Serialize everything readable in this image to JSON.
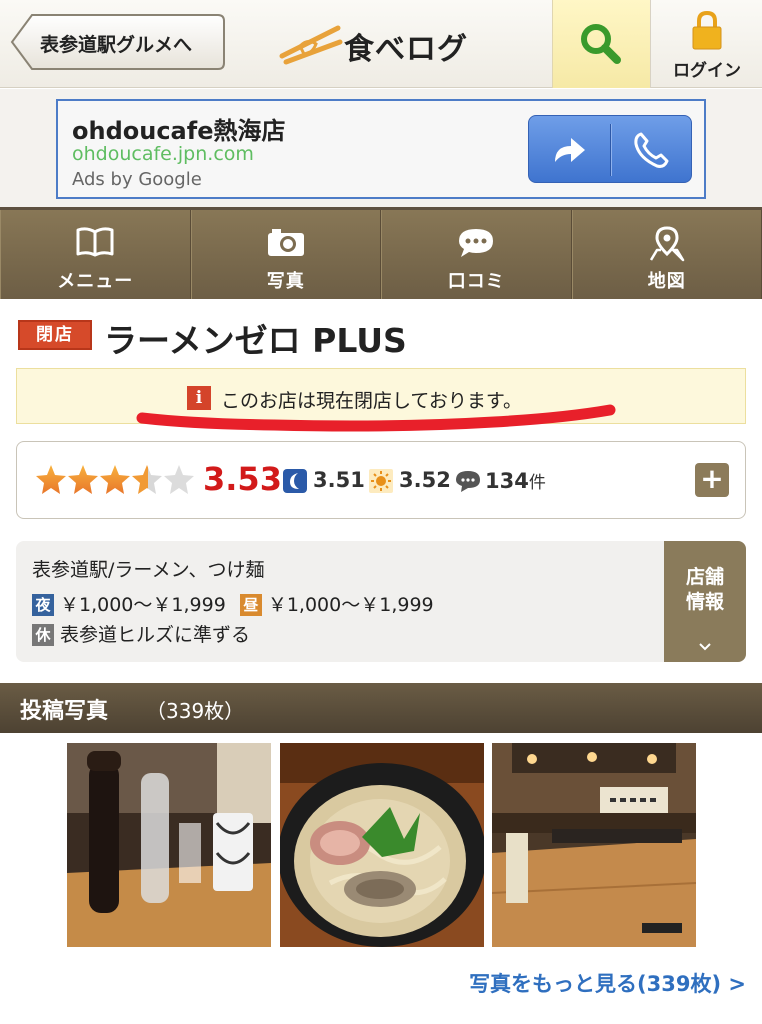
{
  "header": {
    "back_label": "表参道駅グルメへ",
    "logo_text": "食べログ",
    "login_label": "ログイン"
  },
  "ad": {
    "title": "ohdoucafe熱海店",
    "url": "ohdoucafe.jpn.com",
    "by": "Ads by Google"
  },
  "nav": {
    "items": [
      {
        "label": "メニュー",
        "icon": "book-icon"
      },
      {
        "label": "写真",
        "icon": "camera-icon"
      },
      {
        "label": "口コミ",
        "icon": "speech-bubble-icon"
      },
      {
        "label": "地図",
        "icon": "map-pin-icon"
      }
    ]
  },
  "shop": {
    "closed_badge": "閉店",
    "name": "ラーメンゼロ PLUS",
    "notice_icon": "i",
    "notice": "このお店は現在閉店しております。"
  },
  "rating": {
    "stars": 3.53,
    "score": "3.53",
    "night_score": "3.51",
    "lunch_score": "3.52",
    "reviews": "134",
    "reviews_unit": "件",
    "plus": "+"
  },
  "info": {
    "area_genre": "表参道駅/ラーメン、つけ麺",
    "night_tag": "夜",
    "night_price": "￥1,000～￥1,999",
    "lunch_tag": "昼",
    "lunch_price": "￥1,000～￥1,999",
    "holiday_tag": "休",
    "holiday": "表参道ヒルズに準ずる",
    "button_label_1": "店舗",
    "button_label_2": "情報"
  },
  "photos": {
    "title": "投稿写真",
    "count": "（339枚）",
    "more": "写真をもっと見る(339枚) >"
  },
  "colors": {
    "accent_brown": "#7a6a50",
    "closed_red": "#d64a2a",
    "score_red": "#d21a1a",
    "link_blue": "#2f6fbf",
    "ad_blue": "#4d7cc7"
  }
}
